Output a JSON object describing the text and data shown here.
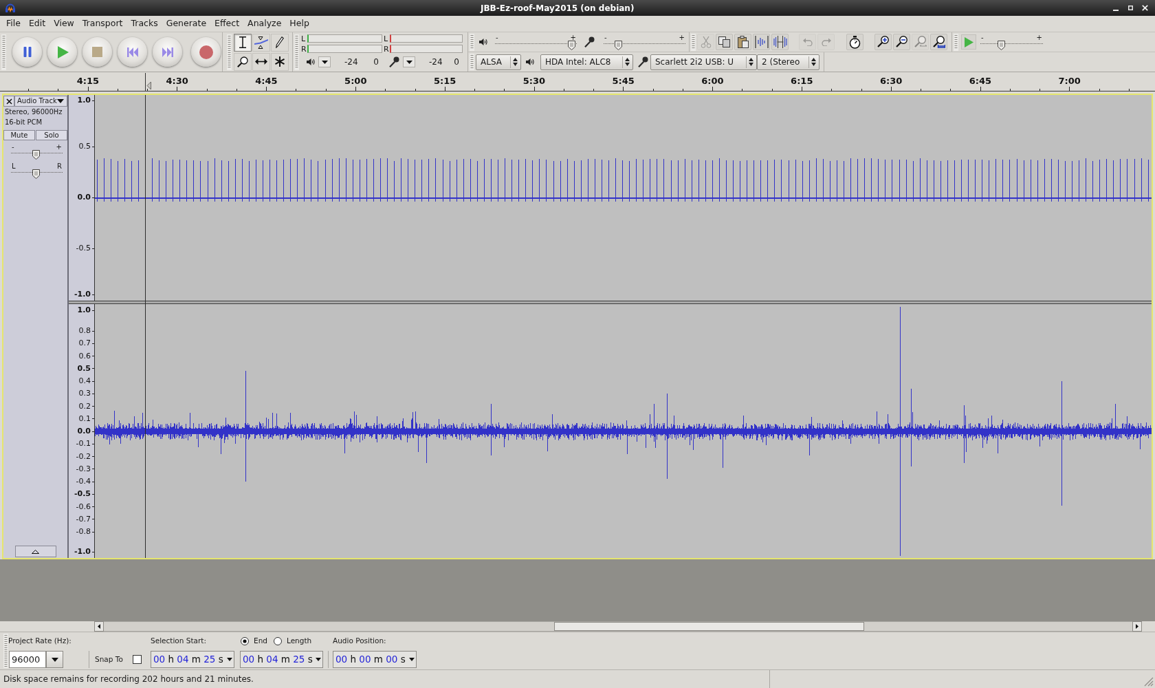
{
  "window": {
    "title": "JBB-Ez-roof-May2015 (on debian)"
  },
  "menu": [
    "File",
    "Edit",
    "View",
    "Transport",
    "Tracks",
    "Generate",
    "Effect",
    "Analyze",
    "Help"
  ],
  "tools": [
    {
      "kind": "selection",
      "selected": true
    },
    {
      "kind": "envelope",
      "selected": false
    },
    {
      "kind": "draw",
      "selected": false
    },
    {
      "kind": "zoom",
      "selected": false
    },
    {
      "kind": "timeshift",
      "selected": false
    },
    {
      "kind": "multi",
      "selected": false
    }
  ],
  "meters": [
    {
      "kind": "playback",
      "channels": [
        "L",
        "R"
      ],
      "scale": [
        "-24",
        "0"
      ]
    },
    {
      "kind": "recording",
      "channels": [
        "L",
        "R"
      ],
      "scale": [
        "-24",
        "0"
      ]
    }
  ],
  "mixer": [
    {
      "kind": "playback",
      "min": "-",
      "max": "+",
      "level": 0.98
    },
    {
      "kind": "recording",
      "min": "-",
      "max": "+",
      "level": 0.15
    }
  ],
  "edit_tools": [
    {
      "kind": "cut",
      "disabled": true
    },
    {
      "kind": "copy",
      "disabled": false
    },
    {
      "kind": "paste",
      "disabled": false
    },
    {
      "kind": "trim",
      "disabled": false
    },
    {
      "kind": "silence",
      "disabled": false
    },
    {
      "kind": "undo",
      "disabled": true
    },
    {
      "kind": "redo",
      "disabled": true
    },
    {
      "kind": "sync_lock",
      "disabled": false
    },
    {
      "kind": "zoom_in",
      "disabled": false
    },
    {
      "kind": "zoom_out",
      "disabled": false
    },
    {
      "kind": "fit_selection",
      "disabled": true
    },
    {
      "kind": "fit_project",
      "disabled": false
    }
  ],
  "play_at_speed": {
    "min": "-",
    "max": "+",
    "level": 0.31
  },
  "devices": [
    {
      "kind": "host",
      "value": "ALSA"
    },
    {
      "kind": "output",
      "value": "HDA Intel: ALC8"
    },
    {
      "kind": "input",
      "value": "Scarlett 2i2 USB: U"
    },
    {
      "kind": "channels",
      "value": "2 (Stereo"
    }
  ],
  "ruler": {
    "labels": [
      "4:15",
      "4:30",
      "4:45",
      "5:00",
      "5:15",
      "5:30",
      "5:45",
      "6:00",
      "6:15",
      "6:30",
      "6:45",
      "7:00"
    ]
  },
  "track": {
    "name": "Audio Track",
    "focused": true,
    "info": [
      "Stereo, 96000Hz",
      "16-bit PCM"
    ],
    "buttons": [
      {
        "label": "Mute",
        "on": false
      },
      {
        "label": "Solo",
        "on": false
      }
    ],
    "gain": {
      "min": "-",
      "max": "+",
      "level": 0.48
    },
    "pan": {
      "min": "L",
      "max": "R",
      "level": 0.48
    },
    "channels": [
      {
        "scale": [
          {
            "label": "1.0",
            "major": true
          },
          {
            "label": "0.5",
            "major": false
          },
          {
            "label": "0.0",
            "major": true
          },
          {
            "label": "-0.5",
            "major": false
          },
          {
            "label": "-1.0",
            "major": true
          }
        ]
      },
      {
        "scale": [
          {
            "label": "1.0",
            "major": true
          },
          {
            "label": "0.8",
            "major": false
          },
          {
            "label": "0.7",
            "major": false
          },
          {
            "label": "0.6",
            "major": false
          },
          {
            "label": "0.5",
            "major": true
          },
          {
            "label": "0.4",
            "major": false
          },
          {
            "label": "0.3",
            "major": false
          },
          {
            "label": "0.2",
            "major": false
          },
          {
            "label": "0.1",
            "major": false
          },
          {
            "label": "0.0",
            "major": true
          },
          {
            "label": "-0.1",
            "major": false
          },
          {
            "label": "-0.2",
            "major": false
          },
          {
            "label": "-0.3",
            "major": false
          },
          {
            "label": "-0.4",
            "major": false
          },
          {
            "label": "-0.5",
            "major": true
          },
          {
            "label": "-0.6",
            "major": false
          },
          {
            "label": "-0.7",
            "major": false
          },
          {
            "label": "-0.8",
            "major": false
          },
          {
            "label": "-1.0",
            "major": true
          }
        ]
      }
    ]
  },
  "selection_bar": {
    "project_rate": {
      "label": "Project Rate (Hz):",
      "value": "96000"
    },
    "snap": {
      "label": "Snap To",
      "checked": false
    },
    "selection_start": {
      "label": "Selection Start:",
      "time": [
        {
          "digits": "00",
          "unit": "h"
        },
        {
          "digits": "04",
          "unit": "m"
        },
        {
          "digits": "25",
          "unit": "s"
        }
      ]
    },
    "end_mode": [
      {
        "label": "End",
        "selected": true
      },
      {
        "label": "Length",
        "selected": false
      }
    ],
    "selection_end": {
      "time": [
        {
          "digits": "00",
          "unit": "h"
        },
        {
          "digits": "04",
          "unit": "m"
        },
        {
          "digits": "25",
          "unit": "s"
        }
      ]
    },
    "audio_position": {
      "label": "Audio Position:",
      "time": [
        {
          "digits": "00",
          "unit": "h"
        },
        {
          "digits": "00",
          "unit": "m"
        },
        {
          "digits": "00",
          "unit": "s"
        }
      ]
    }
  },
  "status_bar": {
    "message": "Disk space remains for recording 202 hours and 21 minutes."
  }
}
